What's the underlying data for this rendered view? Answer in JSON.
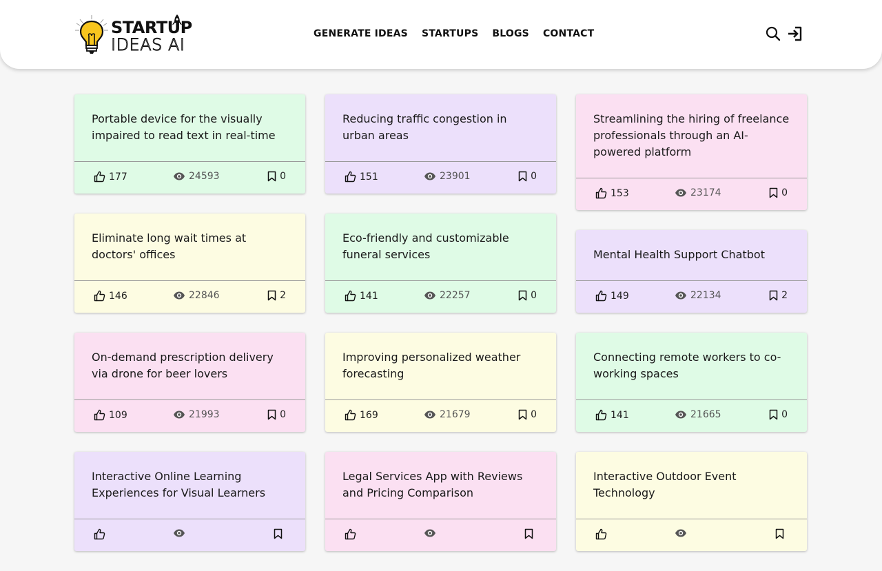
{
  "header": {
    "logo_line1": "STARTUP",
    "logo_line2": "IDEAS AI",
    "nav": [
      "GENERATE IDEAS",
      "STARTUPS",
      "BLOGS",
      "CONTACT"
    ]
  },
  "colors": {
    "green": "#dffbe6",
    "purple": "#ece0fb",
    "pink": "#fbe0f2",
    "yellow": "#fdfce2",
    "bulb": "#f7c51e"
  },
  "columns": [
    [
      {
        "title": "Portable device for the visually impaired to read text in real-time",
        "likes": "177",
        "views": "24593",
        "saves": "0",
        "color": "green"
      },
      {
        "title": "Eliminate long wait times at doctors' offices",
        "likes": "146",
        "views": "22846",
        "saves": "2",
        "color": "yellow"
      },
      {
        "title": "On-demand prescription delivery via drone for beer lovers",
        "likes": "109",
        "views": "21993",
        "saves": "0",
        "color": "pink"
      },
      {
        "title": "Interactive Online Learning Experiences for Visual Learners",
        "likes": "",
        "views": "",
        "saves": "",
        "color": "purple"
      }
    ],
    [
      {
        "title": "Reducing traffic congestion in urban areas",
        "likes": "151",
        "views": "23901",
        "saves": "0",
        "color": "purple"
      },
      {
        "title": "Eco-friendly and customizable funeral services",
        "likes": "141",
        "views": "22257",
        "saves": "0",
        "color": "green"
      },
      {
        "title": "Improving personalized weather forecasting",
        "likes": "169",
        "views": "21679",
        "saves": "0",
        "color": "yellow"
      },
      {
        "title": "Legal Services App with Reviews and Pricing Comparison",
        "likes": "",
        "views": "",
        "saves": "",
        "color": "pink"
      }
    ],
    [
      {
        "title": "Streamlining the hiring of freelance professionals through an AI-powered platform",
        "likes": "153",
        "views": "23174",
        "saves": "0",
        "color": "pink"
      },
      {
        "title": "Mental Health Support Chatbot",
        "likes": "149",
        "views": "22134",
        "saves": "2",
        "color": "purple"
      },
      {
        "title": "Connecting remote workers to co-working spaces",
        "likes": "141",
        "views": "21665",
        "saves": "0",
        "color": "green"
      },
      {
        "title": "Interactive Outdoor Event Technology",
        "likes": "",
        "views": "",
        "saves": "",
        "color": "yellow"
      }
    ]
  ]
}
